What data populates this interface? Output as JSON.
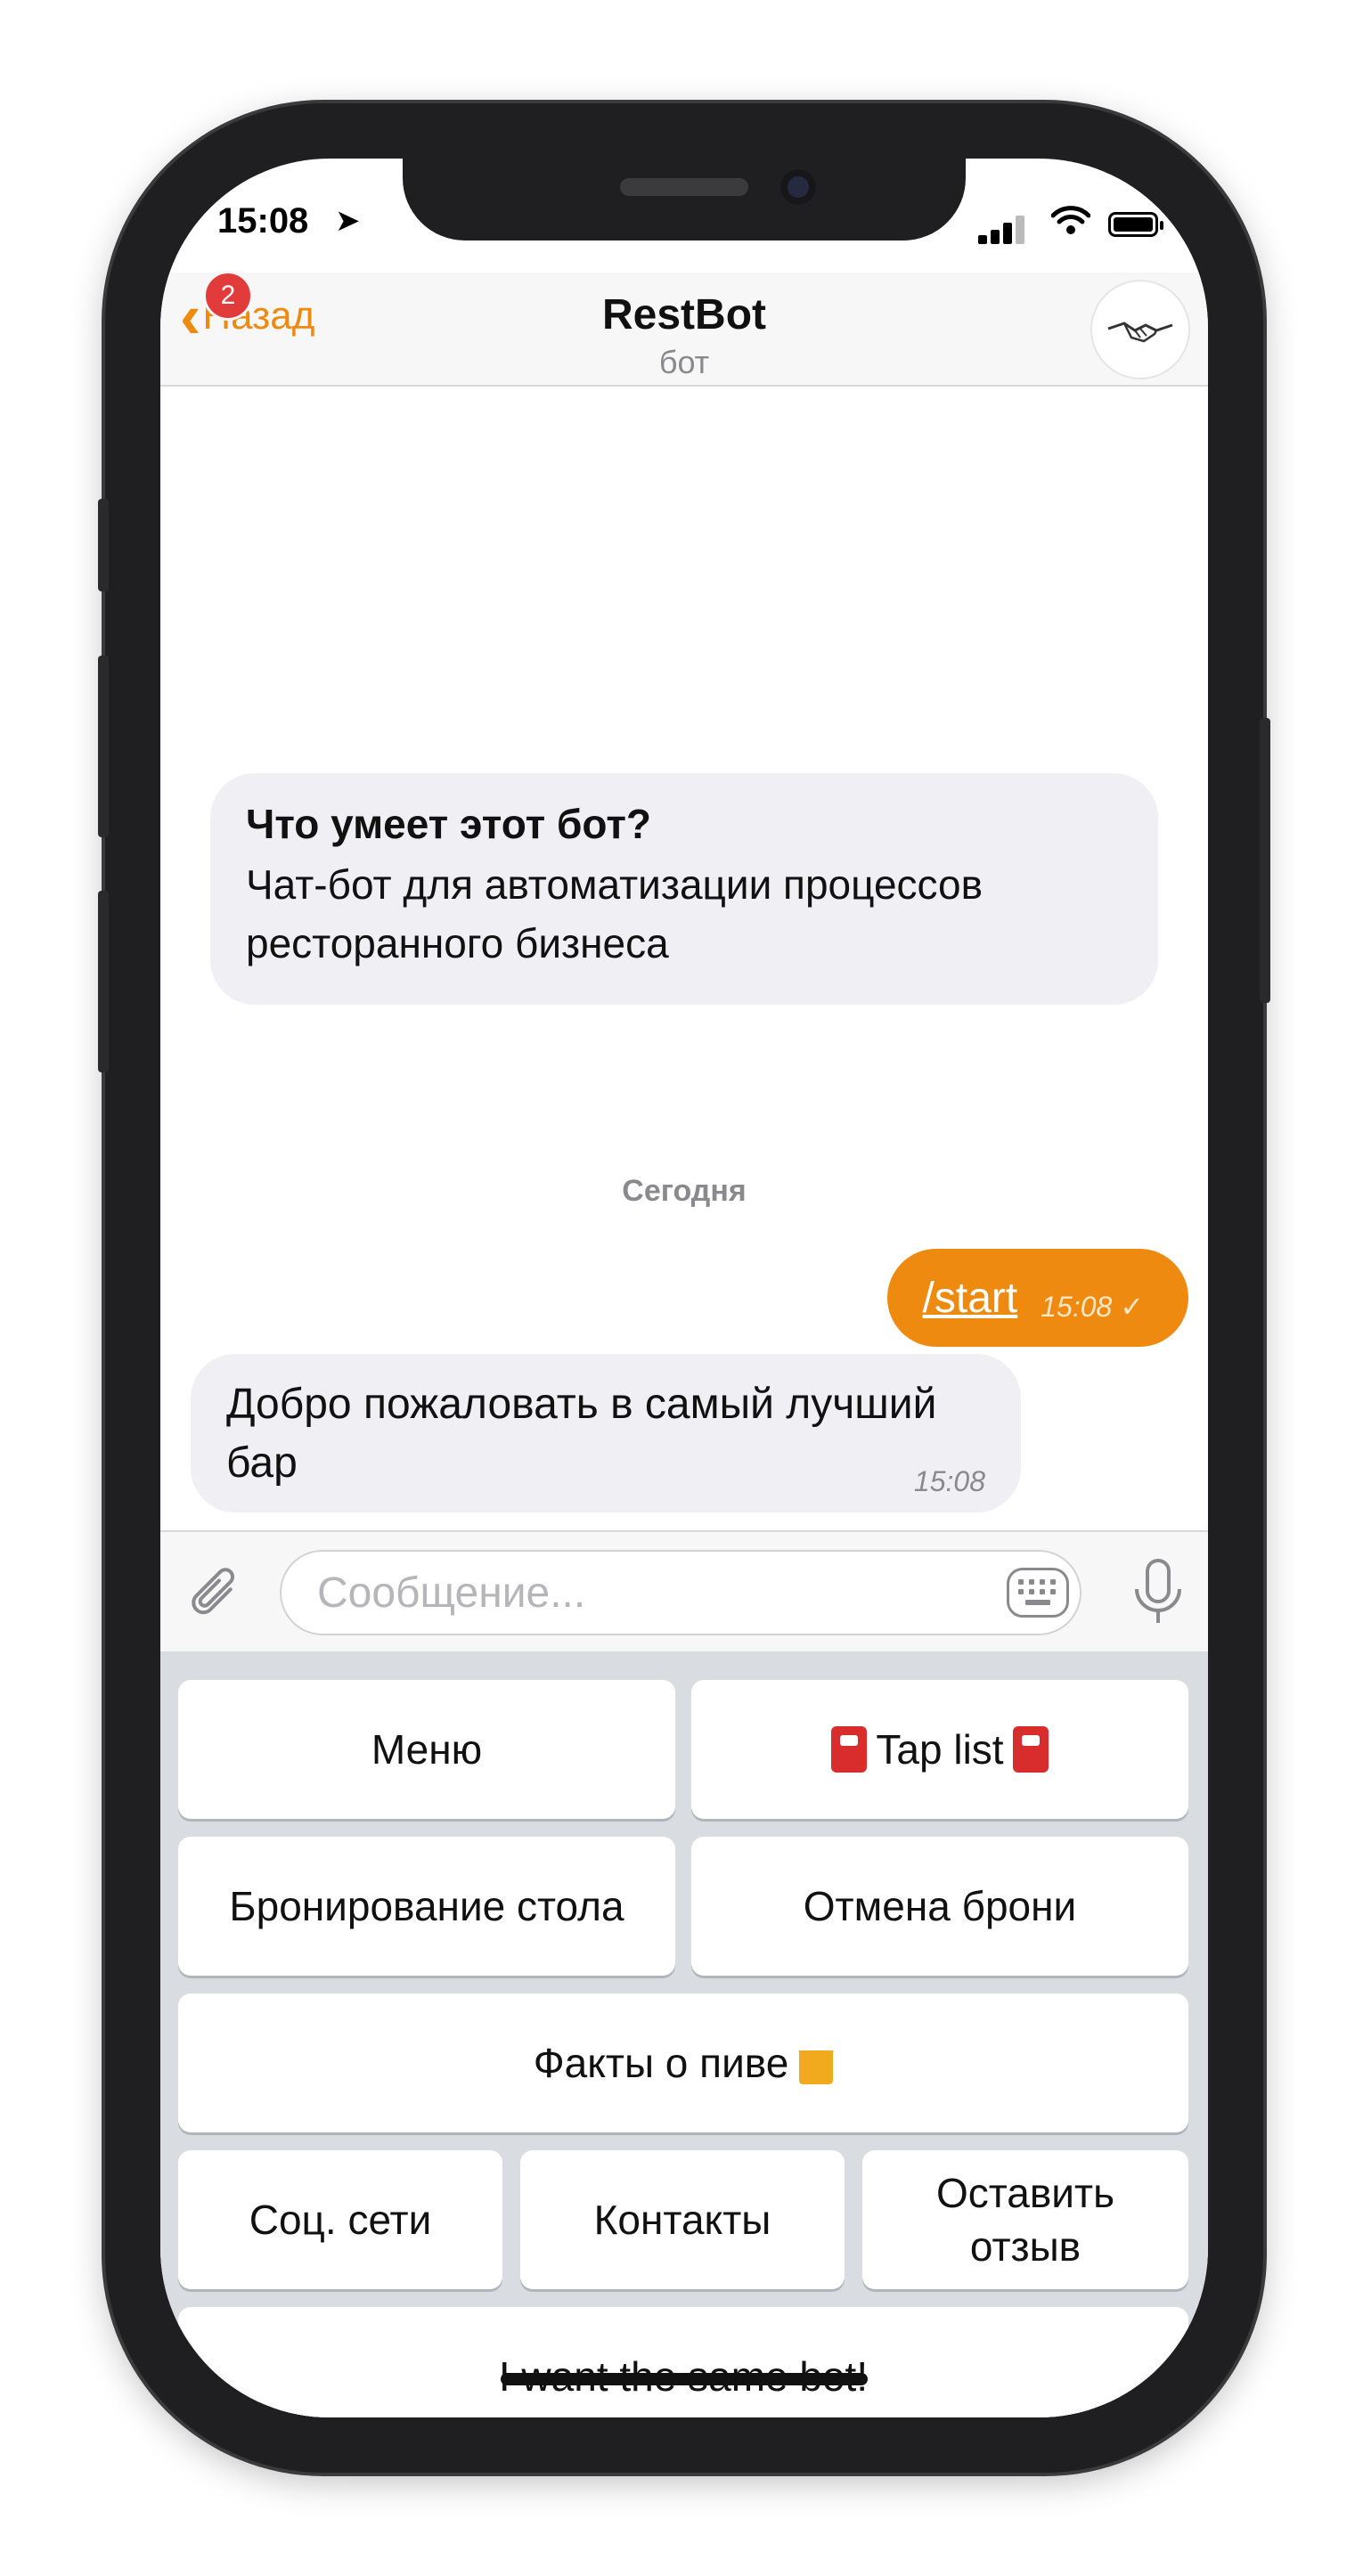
{
  "status": {
    "time": "15:08",
    "location_icon": "location-arrow-icon",
    "signal_icon": "cellular-signal-icon",
    "wifi_icon": "wifi-icon",
    "battery_icon": "battery-icon"
  },
  "header": {
    "back_label": "Назад",
    "badge_count": "2",
    "title": "RestBot",
    "subtitle": "бот",
    "avatar_icon": "handshake-avatar-icon"
  },
  "chat": {
    "info": {
      "title": "Что умеет этот бот?",
      "text": "Чат-бот для автоматизации процессов ресторанного бизнеса"
    },
    "date_separator": "Сегодня",
    "outgoing": {
      "text": "/start",
      "time": "15:08",
      "status_icon": "checkmark-icon"
    },
    "incoming": {
      "text": "Добро пожаловать в самый лучший бар",
      "time": "15:08"
    }
  },
  "input": {
    "placeholder": "Сообщение...",
    "attach_icon": "paperclip-icon",
    "keyboard_icon": "keyboard-icon",
    "mic_icon": "microphone-icon"
  },
  "keyboard": {
    "menu": "Меню",
    "tap_list": "Tap list",
    "booking": "Бронирование стола",
    "cancel_booking": "Отмена брони",
    "beer_facts": "Факты о пиве",
    "social": "Соц. сети",
    "contacts": "Контакты",
    "review": "Оставить отзыв",
    "same_bot": "I want the same bot!"
  },
  "colors": {
    "accent": "#ee8a10",
    "badge": "#e23b3b",
    "bubble_in": "#efeff4",
    "keyboard_bg": "#d9dce1"
  }
}
